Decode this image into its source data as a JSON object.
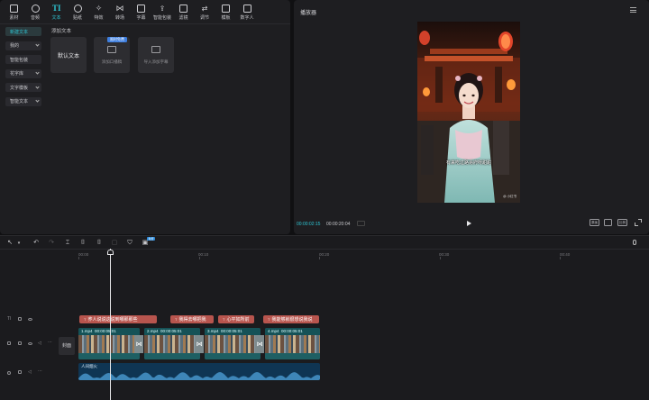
{
  "left_panel": {
    "tabs": [
      {
        "label": "素材",
        "icon": "media-icon"
      },
      {
        "label": "音频",
        "icon": "audio-icon"
      },
      {
        "label": "文本",
        "icon": "text-icon",
        "active": true
      },
      {
        "label": "贴纸",
        "icon": "sticker-icon"
      },
      {
        "label": "特效",
        "icon": "effects-icon"
      },
      {
        "label": "转场",
        "icon": "transition-icon"
      },
      {
        "label": "字幕",
        "icon": "subtitle-icon"
      },
      {
        "label": "智能包装",
        "icon": "smart-pack-icon"
      },
      {
        "label": "滤镜",
        "icon": "filter-icon"
      },
      {
        "label": "调节",
        "icon": "adjust-icon"
      },
      {
        "label": "模板",
        "icon": "template-icon"
      },
      {
        "label": "数字人",
        "icon": "digital-human-icon"
      }
    ],
    "active_tab_glyph": "TI",
    "categories": [
      {
        "label": "新建文本",
        "active": true
      },
      {
        "label": "我的",
        "chevron": true
      },
      {
        "label": "智能包装",
        "chevron": false
      },
      {
        "label": "花字库",
        "chevron": true
      },
      {
        "label": "文字模板",
        "chevron": true
      },
      {
        "label": "智能文本",
        "chevron": true
      }
    ],
    "section_title": "添加文本",
    "cards": {
      "default_text": "默认文本",
      "template_label": "添加口播稿",
      "template_badge": "限时免费",
      "subtitle_label": "导入添加字幕"
    }
  },
  "player": {
    "title": "播放器",
    "caption": "有来吃过路易府呀甜甜",
    "watermark": "@ 小红书",
    "time_current": "00:00:02:15",
    "time_total": "00:00:20:04",
    "controls": {
      "quality": "原画",
      "ratio": "比例"
    }
  },
  "timeline": {
    "tool_badge": "免费",
    "ruler": [
      "00:00",
      "00:10",
      "00:20",
      "00:30",
      "00:40"
    ],
    "cover_label": "封面",
    "text_clips": [
      "荞人说说这说到哪那那些",
      "我得去哪把我",
      "心平如所前",
      "我能够就很想说我说"
    ],
    "video_clips": [
      {
        "name": "1.mp4",
        "duration": "00:00:05:01"
      },
      {
        "name": "2.mp4",
        "duration": "00:00:05:01"
      },
      {
        "name": "3.mp4",
        "duration": "00:00:05:01"
      },
      {
        "name": "4.mp4",
        "duration": "00:00:05:01"
      }
    ],
    "audio_label": "人间烟火"
  }
}
